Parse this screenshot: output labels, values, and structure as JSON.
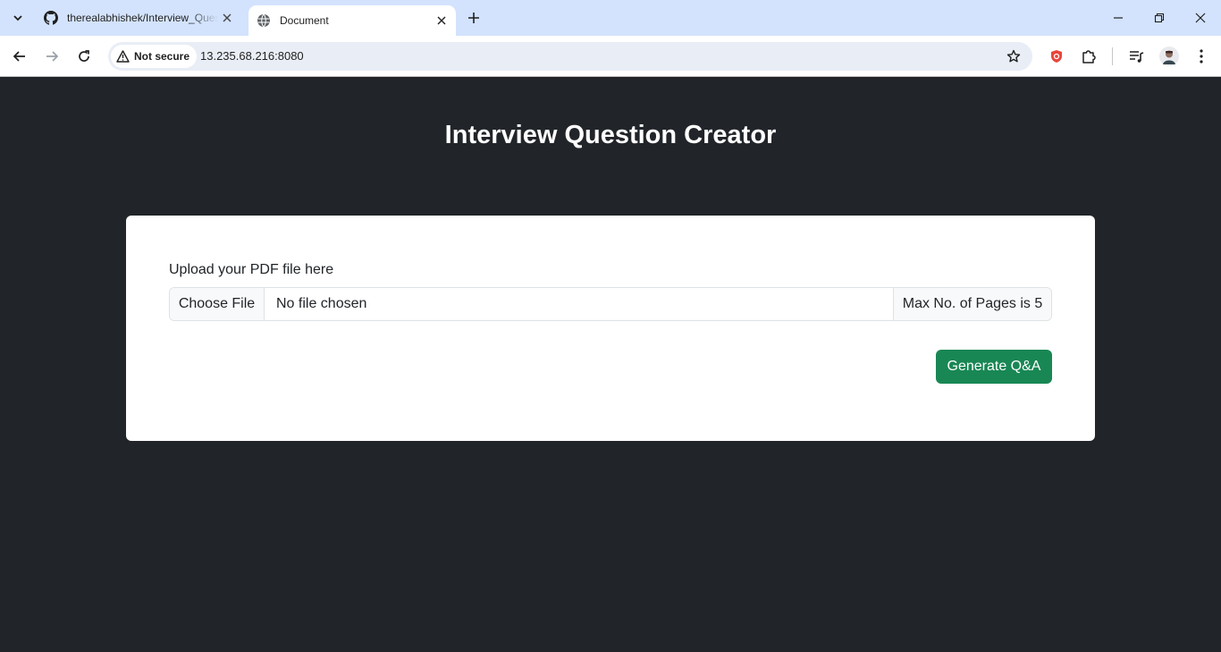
{
  "browser": {
    "tabs": [
      {
        "title": "therealabhishek/Interview_Question_Creator",
        "active": false,
        "favicon": "github-icon"
      },
      {
        "title": "Document",
        "active": true,
        "favicon": "globe-icon"
      }
    ],
    "security_label": "Not secure",
    "url": "13.235.68.216:8080"
  },
  "page": {
    "title": "Interview Question Creator",
    "upload_label": "Upload your PDF file here",
    "choose_file_label": "Choose File",
    "file_status": "No file chosen",
    "max_pages_note": "Max No. of Pages is 5",
    "generate_button": "Generate Q&A"
  },
  "colors": {
    "page_background": "#212529",
    "card_background": "#ffffff",
    "primary_button": "#198754",
    "tabbar": "#d3e3fd"
  }
}
